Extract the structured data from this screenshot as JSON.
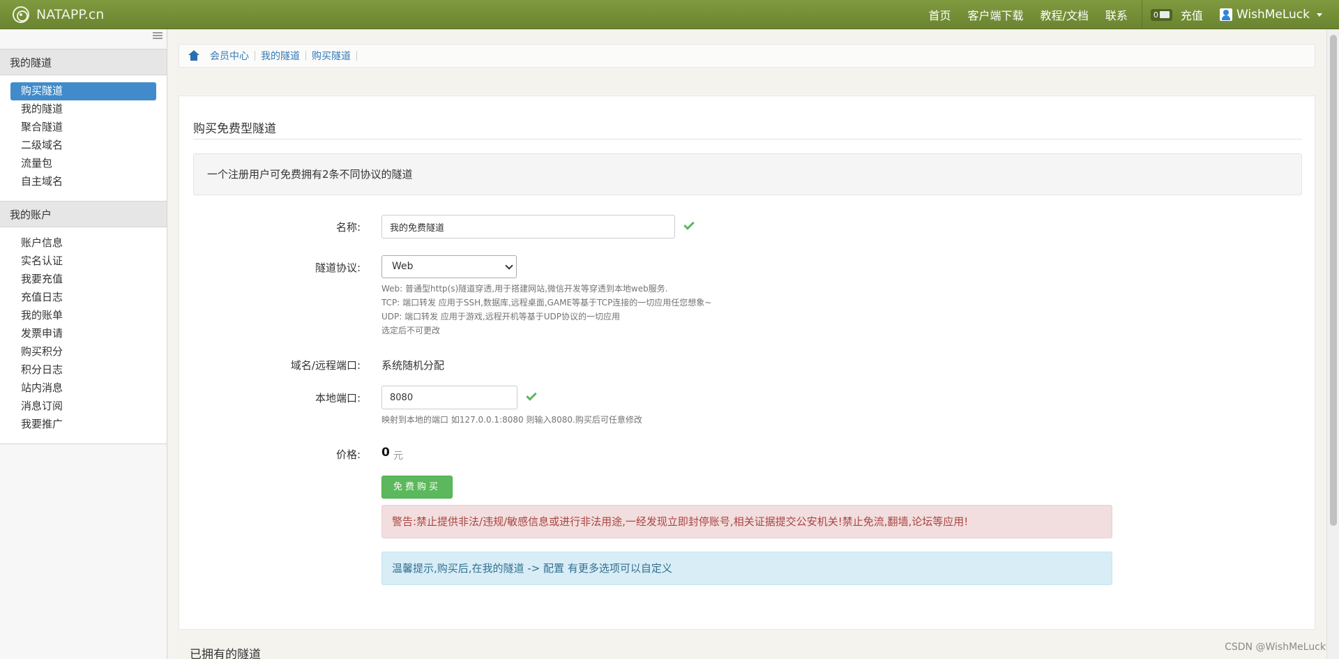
{
  "navbar": {
    "brand": "NATAPP.cn",
    "links": [
      "首页",
      "客户端下载",
      "教程/文档",
      "联系"
    ],
    "message_count": "0",
    "recharge": "充值",
    "username": "WishMeLuck"
  },
  "sidebar": {
    "section1": "我的隧道",
    "tunnel_items": [
      "购买隧道",
      "我的隧道",
      "聚合隧道",
      "二级域名",
      "流量包",
      "自主域名"
    ],
    "section2": "我的账户",
    "account_items": [
      "账户信息",
      "实名认证",
      "我要充值",
      "充值日志",
      "我的账单",
      "发票申请",
      "购买积分",
      "积分日志",
      "站内消息",
      "消息订阅",
      "我要推广"
    ]
  },
  "breadcrumb": [
    "会员中心",
    "我的隧道",
    "购买隧道"
  ],
  "form": {
    "title": "购买免费型隧道",
    "notice": "一个注册用户可免费拥有2条不同协议的隧道",
    "name_label": "名称:",
    "name_value": "我的免费隧道",
    "protocol_label": "隧道协议:",
    "protocol_value": "Web",
    "protocol_help": [
      "Web: 普通型http(s)隧道穿透,用于搭建网站,微信开发等穿透到本地web服务.",
      "TCP: 端口转发 应用于SSH,数据库,远程桌面,GAME等基于TCP连接的一切应用任您想象~",
      "UDP: 端口转发 应用于游戏,远程开机等基于UDP协议的一切应用",
      "选定后不可更改"
    ],
    "domain_label": "域名/远程端口:",
    "domain_value": "系统随机分配",
    "port_label": "本地端口:",
    "port_value": "8080",
    "port_help": "映射到本地的端口 如127.0.0.1:8080 则输入8080.购买后可任意修改",
    "price_label": "价格:",
    "price_value": "0",
    "price_unit": "元",
    "buy_button": "免费购买",
    "warning": "警告:禁止提供非法/违规/敏感信息或进行非法用途,一经发现立即封停账号,相关证据提交公安机关!禁止免流,翻墙,论坛等应用!",
    "tip": "温馨提示,购买后,在我的隧道 -> 配置 有更多选项可以自定义"
  },
  "owned_title": "已拥有的隧道",
  "watermark": "CSDN @WishMeLuck*"
}
